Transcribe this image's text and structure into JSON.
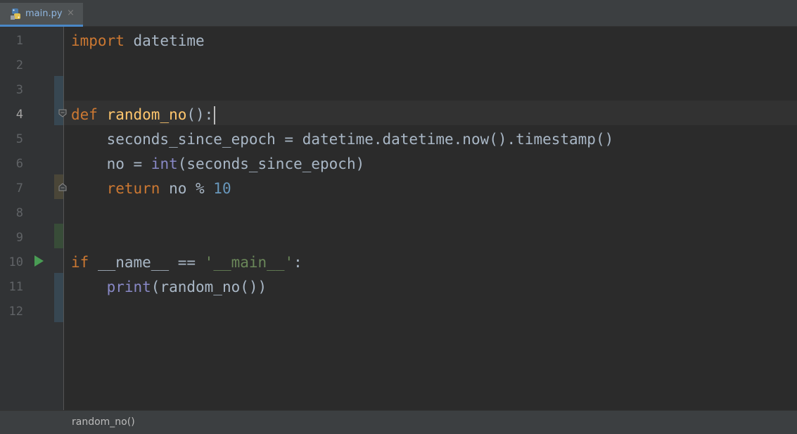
{
  "tab": {
    "file_name": "main.py",
    "close_symbol": "×",
    "icon": "python-file-icon"
  },
  "editor": {
    "current_line": 4,
    "line_numbers": [
      "1",
      "2",
      "3",
      "4",
      "5",
      "6",
      "7",
      "8",
      "9",
      "10",
      "11",
      "12"
    ],
    "code": {
      "l1": {
        "kw": "import",
        "rest": " datetime"
      },
      "l4": {
        "kw": "def",
        "sp": " ",
        "fn": "random_no",
        "rest": "():"
      },
      "l5": {
        "text": "    seconds_since_epoch = datetime.datetime.now().timestamp()"
      },
      "l6": {
        "pre": "    no = ",
        "bi": "int",
        "rest": "(seconds_since_epoch)"
      },
      "l7": {
        "pre": "    ",
        "kw": "return",
        "mid": " no % ",
        "num": "10"
      },
      "l10": {
        "kw": "if",
        "mid": " __name__ == ",
        "str": "'__main__'",
        "rest": ":"
      },
      "l11": {
        "pre": "    ",
        "bi": "print",
        "rest": "(random_no())"
      }
    },
    "colors": {
      "keyword": "#cc7832",
      "function": "#ffc66d",
      "builtin": "#8888c6",
      "number": "#6897bb",
      "string": "#6a8759",
      "text": "#a9b7c6",
      "background": "#2b2b2b",
      "gutter": "#313335",
      "run": "#499c54"
    }
  },
  "breadcrumb": {
    "text": "random_no()"
  }
}
